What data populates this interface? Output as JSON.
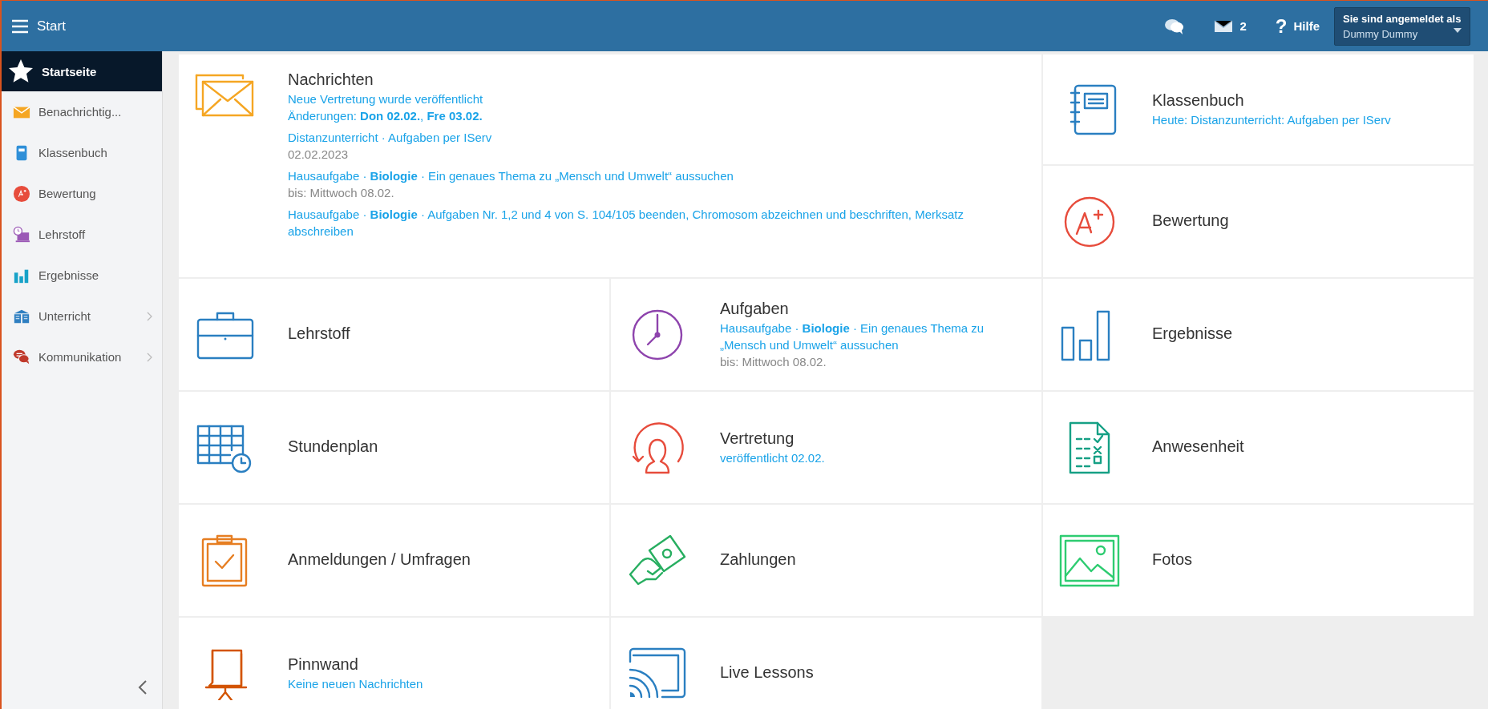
{
  "topbar": {
    "title": "Start",
    "messages_count": "2",
    "help_glyph": "?",
    "help_label": "Hilfe",
    "user_caption": "Sie sind angemeldet als",
    "user_name": "Dummy Dummy"
  },
  "sidebar": {
    "items": [
      {
        "label": "Startseite",
        "selected": true,
        "has_submenu": false
      },
      {
        "label": "Benachrichtig...",
        "selected": false,
        "has_submenu": false
      },
      {
        "label": "Klassenbuch",
        "selected": false,
        "has_submenu": false
      },
      {
        "label": "Bewertung",
        "selected": false,
        "has_submenu": false
      },
      {
        "label": "Lehrstoff",
        "selected": false,
        "has_submenu": false
      },
      {
        "label": "Ergebnisse",
        "selected": false,
        "has_submenu": false
      },
      {
        "label": "Unterricht",
        "selected": false,
        "has_submenu": true
      },
      {
        "label": "Kommunikation",
        "selected": false,
        "has_submenu": true
      }
    ]
  },
  "tiles": [
    {
      "title": "Nachrichten",
      "groups": [
        [
          {
            "kind": "link",
            "text": "Neue Vertretung wurde veröffentlicht"
          },
          {
            "kind": "link",
            "text": "Änderungen: **Don 02.02.**, **Fre 03.02.**"
          }
        ],
        [
          {
            "kind": "link",
            "text": "Distanzunterricht · Aufgaben per IServ"
          },
          {
            "kind": "meta",
            "text": "02.02.2023"
          }
        ],
        [
          {
            "kind": "link",
            "text": "Hausaufgabe · **Biologie** · Ein genaues Thema zu „Mensch und Umwelt“ aussuchen"
          },
          {
            "kind": "meta",
            "text": "bis: Mittwoch 08.02."
          }
        ],
        [
          {
            "kind": "link",
            "text": "Hausaufgabe · **Biologie** · Aufgaben Nr. 1,2 und 4 von S. 104/105 beenden, Chromosom abzeichnen und beschriften, Merksatz abschreiben"
          }
        ]
      ]
    },
    {
      "title": "Klassenbuch",
      "groups": [
        [
          {
            "kind": "link",
            "text": "Heute: Distanzunterricht: Aufgaben per IServ"
          }
        ]
      ]
    },
    {
      "title": "Bewertung"
    },
    {
      "title": "Lehrstoff"
    },
    {
      "title": "Aufgaben",
      "groups": [
        [
          {
            "kind": "link",
            "text": "Hausaufgabe · **Biologie** · Ein genaues Thema zu „Mensch und Umwelt“ aussuchen"
          },
          {
            "kind": "meta",
            "text": "bis: Mittwoch 08.02."
          }
        ]
      ]
    },
    {
      "title": "Ergebnisse"
    },
    {
      "title": "Stundenplan"
    },
    {
      "title": "Vertretung",
      "groups": [
        [
          {
            "kind": "link",
            "text": "veröffentlicht 02.02."
          }
        ]
      ]
    },
    {
      "title": "Anwesenheit"
    },
    {
      "title": "Anmeldungen / Umfragen"
    },
    {
      "title": "Zahlungen"
    },
    {
      "title": "Fotos"
    },
    {
      "title": "Pinnwand",
      "groups": [
        [
          {
            "kind": "link",
            "text": "Keine neuen Nachrichten"
          }
        ]
      ]
    },
    {
      "title": "Live Lessons"
    }
  ]
}
